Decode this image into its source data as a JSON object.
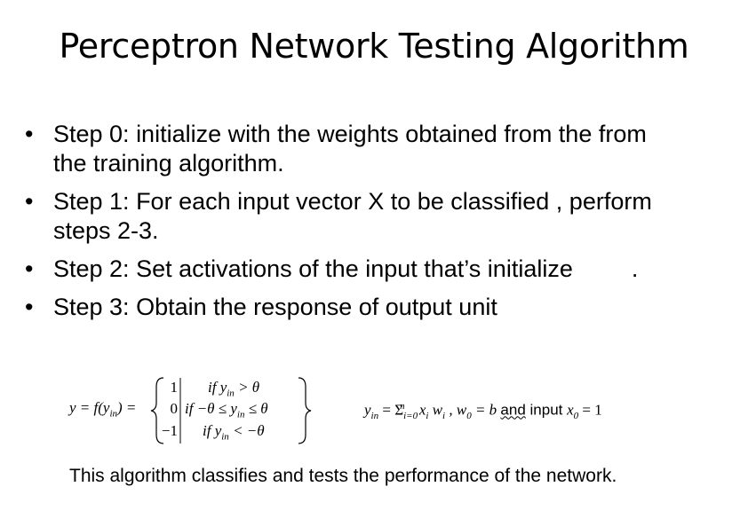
{
  "title": "Perceptron Network Testing Algorithm",
  "bullets": [
    {
      "lines": [
        "Step 0: initialize with the weights obtained from the from",
        "the training algorithm."
      ]
    },
    {
      "lines": [
        "Step 1: For each input vector X to be classified , perform",
        "steps 2-3."
      ]
    },
    {
      "lines": [
        "Step 2: Set activations of the input that’s initialize",
        "."
      ]
    },
    {
      "lines": [
        "Step 3: Obtain the response of output unit"
      ]
    }
  ],
  "activation_formula": {
    "lhs": "y = f(y",
    "lhs_sub": "in",
    "lhs_tail": ") =",
    "cases": [
      {
        "value": "1",
        "condition": "if y",
        "sub": "in",
        "tail": " > θ"
      },
      {
        "value": "0",
        "condition": "if −θ ≤ y",
        "sub": "in",
        "tail": " ≤ θ"
      },
      {
        "value": "−1",
        "condition": "if y",
        "sub": "in",
        "tail": " < −θ"
      }
    ]
  },
  "net_input_formula": {
    "y": "y",
    "y_sub": "in",
    "eq": " = Σ",
    "sum_sub": "i=0",
    "sum_sup": "n",
    "term": " x",
    "term_sub1": "i",
    "w": " w",
    "w_sub": "i",
    "w0": " , w",
    "w0_sub": "0",
    "b": "  = b",
    "and_word": "and",
    "input_word": " input ",
    "x0": "x",
    "x0_sub": "0",
    "one": " = 1"
  },
  "caption": "This algorithm classifies and tests the performance of the network."
}
